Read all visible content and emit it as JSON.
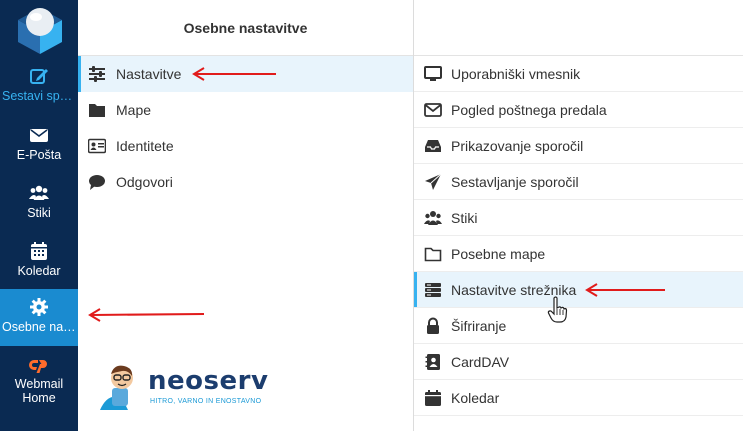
{
  "nav": {
    "items": [
      {
        "label": "Sestavi spo..."
      },
      {
        "label": "E-Pošta"
      },
      {
        "label": "Stiki"
      },
      {
        "label": "Koledar"
      },
      {
        "label": "Osebne nas..."
      },
      {
        "label": "Webmail Home"
      }
    ]
  },
  "settings": {
    "title": "Osebne nastavitve",
    "sections": [
      {
        "label": "Nastavitve",
        "icon": "sliders-icon"
      },
      {
        "label": "Mape",
        "icon": "folder-icon"
      },
      {
        "label": "Identitete",
        "icon": "id-card-icon"
      },
      {
        "label": "Odgovori",
        "icon": "comment-icon"
      }
    ]
  },
  "preferences": {
    "items": [
      {
        "label": "Uporabniški vmesnik",
        "icon": "monitor-icon"
      },
      {
        "label": "Pogled poštnega predala",
        "icon": "envelope-icon"
      },
      {
        "label": "Prikazovanje sporočil",
        "icon": "inbox-icon"
      },
      {
        "label": "Sestavljanje sporočil",
        "icon": "paper-plane-icon"
      },
      {
        "label": "Stiki",
        "icon": "users-icon"
      },
      {
        "label": "Posebne mape",
        "icon": "folder-outline-icon"
      },
      {
        "label": "Nastavitve strežnika",
        "icon": "server-icon"
      },
      {
        "label": "Šifriranje",
        "icon": "lock-icon"
      },
      {
        "label": "CardDAV",
        "icon": "address-book-icon"
      },
      {
        "label": "Koledar",
        "icon": "calendar-icon"
      }
    ]
  },
  "brand": {
    "name": "neoserv",
    "tagline": "HITRO, VARNO IN ENOSTAVNO"
  },
  "colors": {
    "nav_bg": "#0a2a52",
    "nav_active": "#1a8bd0",
    "accent": "#37b2f0",
    "selected_bg": "#e8f4fc",
    "annotation_red": "#e11b1b"
  }
}
